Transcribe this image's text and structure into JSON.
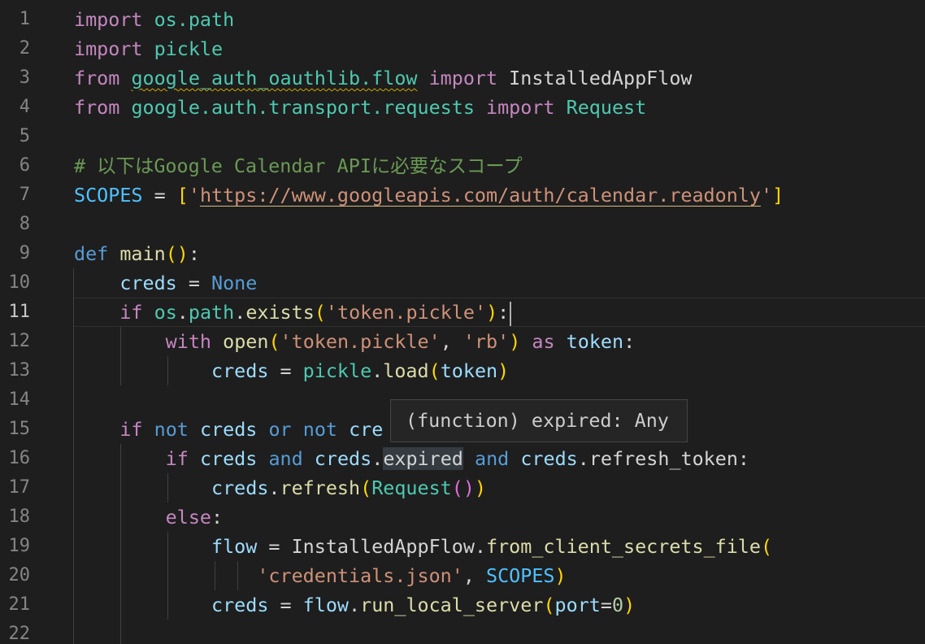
{
  "editor": {
    "language": "python",
    "current_line": 11,
    "lines": [
      {
        "n": "1",
        "tokens": [
          [
            "kw",
            "import"
          ],
          [
            "txt",
            " "
          ],
          [
            "mod",
            "os.path"
          ]
        ]
      },
      {
        "n": "2",
        "tokens": [
          [
            "kw",
            "import"
          ],
          [
            "txt",
            " "
          ],
          [
            "mod",
            "pickle"
          ]
        ]
      },
      {
        "n": "3",
        "tokens": [
          [
            "kw",
            "from"
          ],
          [
            "txt",
            " "
          ],
          [
            "mod squig",
            "google_auth_oauthlib.flow"
          ],
          [
            "txt",
            " "
          ],
          [
            "kw",
            "import"
          ],
          [
            "txt",
            " InstalledAppFlow"
          ]
        ]
      },
      {
        "n": "4",
        "tokens": [
          [
            "kw",
            "from"
          ],
          [
            "txt",
            " "
          ],
          [
            "mod",
            "google.auth.transport.requests"
          ],
          [
            "txt",
            " "
          ],
          [
            "kw",
            "import"
          ],
          [
            "txt",
            " "
          ],
          [
            "cls",
            "Request"
          ]
        ]
      },
      {
        "n": "5",
        "tokens": []
      },
      {
        "n": "6",
        "tokens": [
          [
            "cmt",
            "# 以下はGoogle Calendar APIに必要なスコープ"
          ]
        ]
      },
      {
        "n": "7",
        "tokens": [
          [
            "const",
            "SCOPES"
          ],
          [
            "txt",
            " = "
          ],
          [
            "br1",
            "["
          ],
          [
            "str",
            "'"
          ],
          [
            "str dotted",
            "https://www.googleapis.com/auth/calendar.readonly"
          ],
          [
            "str",
            "'"
          ],
          [
            "br1",
            "]"
          ]
        ]
      },
      {
        "n": "8",
        "tokens": []
      },
      {
        "n": "9",
        "tokens": [
          [
            "def",
            "def"
          ],
          [
            "txt",
            " "
          ],
          [
            "fn",
            "main"
          ],
          [
            "br1",
            "()"
          ],
          [
            "txt",
            ":"
          ]
        ]
      },
      {
        "n": "10",
        "tokens": [
          [
            "txt",
            "    "
          ],
          [
            "var",
            "creds"
          ],
          [
            "txt",
            " = "
          ],
          [
            "def",
            "None"
          ]
        ]
      },
      {
        "n": "11",
        "tokens": [
          [
            "txt",
            "    "
          ],
          [
            "kw",
            "if"
          ],
          [
            "txt",
            " "
          ],
          [
            "mod",
            "os"
          ],
          [
            "txt",
            "."
          ],
          [
            "mod",
            "path"
          ],
          [
            "txt",
            "."
          ],
          [
            "fn",
            "exists"
          ],
          [
            "br1",
            "("
          ],
          [
            "str",
            "'token.pickle'"
          ],
          [
            "br1",
            ")"
          ],
          [
            "txt",
            ":"
          ]
        ]
      },
      {
        "n": "12",
        "tokens": [
          [
            "txt",
            "        "
          ],
          [
            "kw",
            "with"
          ],
          [
            "txt",
            " "
          ],
          [
            "fn",
            "open"
          ],
          [
            "br1",
            "("
          ],
          [
            "str",
            "'token.pickle'"
          ],
          [
            "txt",
            ", "
          ],
          [
            "str",
            "'rb'"
          ],
          [
            "br1",
            ")"
          ],
          [
            "txt",
            " "
          ],
          [
            "kw",
            "as"
          ],
          [
            "txt",
            " "
          ],
          [
            "var",
            "token"
          ],
          [
            "txt",
            ":"
          ]
        ]
      },
      {
        "n": "13",
        "tokens": [
          [
            "txt",
            "            "
          ],
          [
            "var",
            "creds"
          ],
          [
            "txt",
            " = "
          ],
          [
            "mod",
            "pickle"
          ],
          [
            "txt",
            "."
          ],
          [
            "fn",
            "load"
          ],
          [
            "br1",
            "("
          ],
          [
            "var",
            "token"
          ],
          [
            "br1",
            ")"
          ]
        ]
      },
      {
        "n": "14",
        "tokens": []
      },
      {
        "n": "15",
        "tokens": [
          [
            "txt",
            "    "
          ],
          [
            "kw",
            "if"
          ],
          [
            "txt",
            " "
          ],
          [
            "bi",
            "not"
          ],
          [
            "txt",
            " "
          ],
          [
            "var",
            "creds"
          ],
          [
            "txt",
            " "
          ],
          [
            "bi",
            "or"
          ],
          [
            "txt",
            " "
          ],
          [
            "bi",
            "not"
          ],
          [
            "txt",
            " "
          ],
          [
            "var",
            "cre"
          ]
        ]
      },
      {
        "n": "16",
        "tokens": [
          [
            "txt",
            "        "
          ],
          [
            "kw",
            "if"
          ],
          [
            "txt",
            " "
          ],
          [
            "var",
            "creds"
          ],
          [
            "txt",
            " "
          ],
          [
            "bi",
            "and"
          ],
          [
            "txt",
            " "
          ],
          [
            "var",
            "creds"
          ],
          [
            "txt",
            "."
          ],
          [
            "txt hl",
            "expired"
          ],
          [
            "txt",
            " "
          ],
          [
            "bi",
            "and"
          ],
          [
            "txt",
            " "
          ],
          [
            "var",
            "creds"
          ],
          [
            "txt",
            ".refresh_token:"
          ]
        ]
      },
      {
        "n": "17",
        "tokens": [
          [
            "txt",
            "            "
          ],
          [
            "var",
            "creds"
          ],
          [
            "txt",
            "."
          ],
          [
            "fn",
            "refresh"
          ],
          [
            "br1",
            "("
          ],
          [
            "cls",
            "Request"
          ],
          [
            "br2",
            "()"
          ],
          [
            "br1",
            ")"
          ]
        ]
      },
      {
        "n": "18",
        "tokens": [
          [
            "txt",
            "        "
          ],
          [
            "kw",
            "else"
          ],
          [
            "txt",
            ":"
          ]
        ]
      },
      {
        "n": "19",
        "tokens": [
          [
            "txt",
            "            "
          ],
          [
            "var",
            "flow"
          ],
          [
            "txt",
            " = InstalledAppFlow."
          ],
          [
            "fn",
            "from_client_secrets_file"
          ],
          [
            "br1",
            "("
          ]
        ]
      },
      {
        "n": "20",
        "tokens": [
          [
            "txt",
            "                "
          ],
          [
            "str",
            "'credentials.json'"
          ],
          [
            "txt",
            ", "
          ],
          [
            "const",
            "SCOPES"
          ],
          [
            "br1",
            ")"
          ]
        ]
      },
      {
        "n": "21",
        "tokens": [
          [
            "txt",
            "            "
          ],
          [
            "var",
            "creds"
          ],
          [
            "txt",
            " = "
          ],
          [
            "var",
            "flow"
          ],
          [
            "txt",
            "."
          ],
          [
            "fn",
            "run_local_server"
          ],
          [
            "br1",
            "("
          ],
          [
            "var",
            "port"
          ],
          [
            "txt",
            "="
          ],
          [
            "num",
            "0"
          ],
          [
            "br1",
            ")"
          ]
        ]
      },
      {
        "n": "22",
        "tokens": []
      }
    ]
  },
  "hover_tooltip": {
    "text": "(function) expired: Any"
  }
}
